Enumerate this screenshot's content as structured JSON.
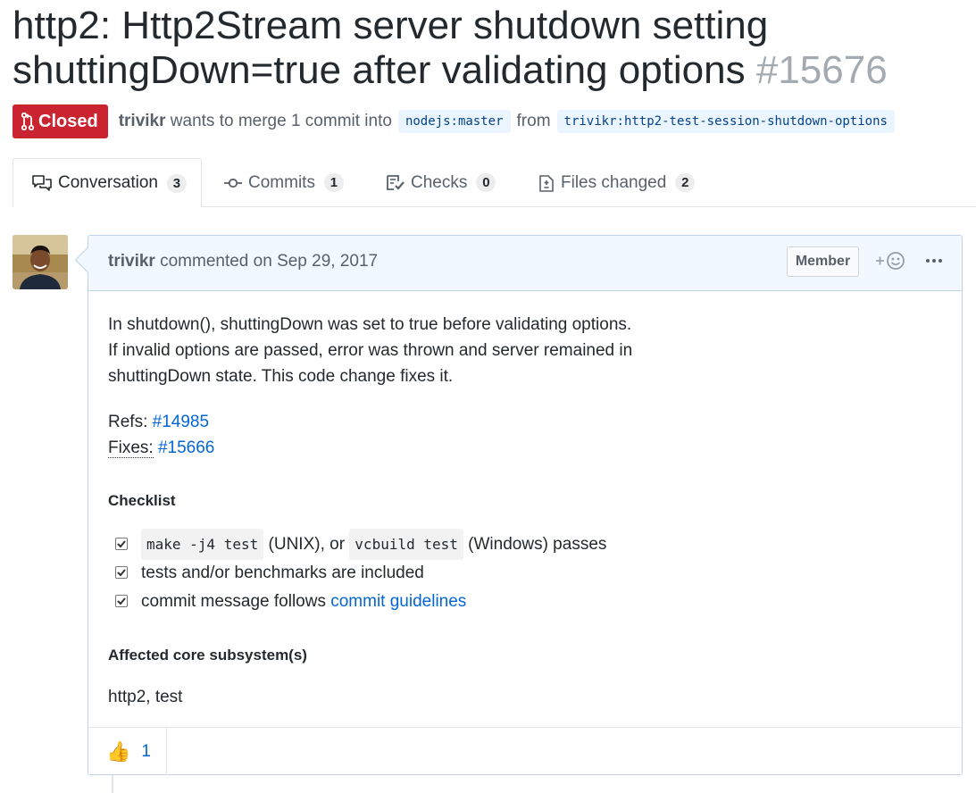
{
  "pr": {
    "title": "http2: Http2Stream server shutdown setting shuttingDown=true after validating options",
    "number": "#15676",
    "state": "Closed",
    "author": "trivikr",
    "meta_text": "wants to merge 1 commit into",
    "base_branch": "nodejs:master",
    "from_text": "from",
    "head_branch": "trivikr:http2-test-session-shutdown-options"
  },
  "tabs": [
    {
      "label": "Conversation",
      "count": "3",
      "icon": "comment-discussion-icon",
      "selected": true
    },
    {
      "label": "Commits",
      "count": "1",
      "icon": "git-commit-icon"
    },
    {
      "label": "Checks",
      "count": "0",
      "icon": "checklist-icon"
    },
    {
      "label": "Files changed",
      "count": "2",
      "icon": "file-diff-icon"
    }
  ],
  "comment": {
    "author": "trivikr",
    "action": "commented on",
    "date": "Sep 29, 2017",
    "badge": "Member",
    "body": {
      "lines": [
        "In shutdown(), shuttingDown was set to true before validating options.",
        "If invalid options are passed, error was thrown and server remained in",
        "shuttingDown state. This code change fixes it."
      ],
      "refs_label": "Refs:",
      "refs_link": "#14985",
      "fixes_label": "Fixes:",
      "fixes_link": "#15666",
      "checklist_heading": "Checklist",
      "task1_code1": "make -j4 test",
      "task1_text1": "(UNIX), or",
      "task1_code2": "vcbuild test",
      "task1_text2": "(Windows) passes",
      "task2_text": "tests and/or benchmarks are included",
      "task3_text": "commit message follows",
      "task3_link": "commit guidelines",
      "subsystems_heading": "Affected core subsystem(s)",
      "subsystems": "http2, test"
    },
    "reactions": [
      {
        "emoji": "👍",
        "count": "1"
      }
    ]
  },
  "colors": {
    "closed": "#cb2431",
    "link": "#0366d6",
    "header_bg": "#f1f8ff"
  }
}
